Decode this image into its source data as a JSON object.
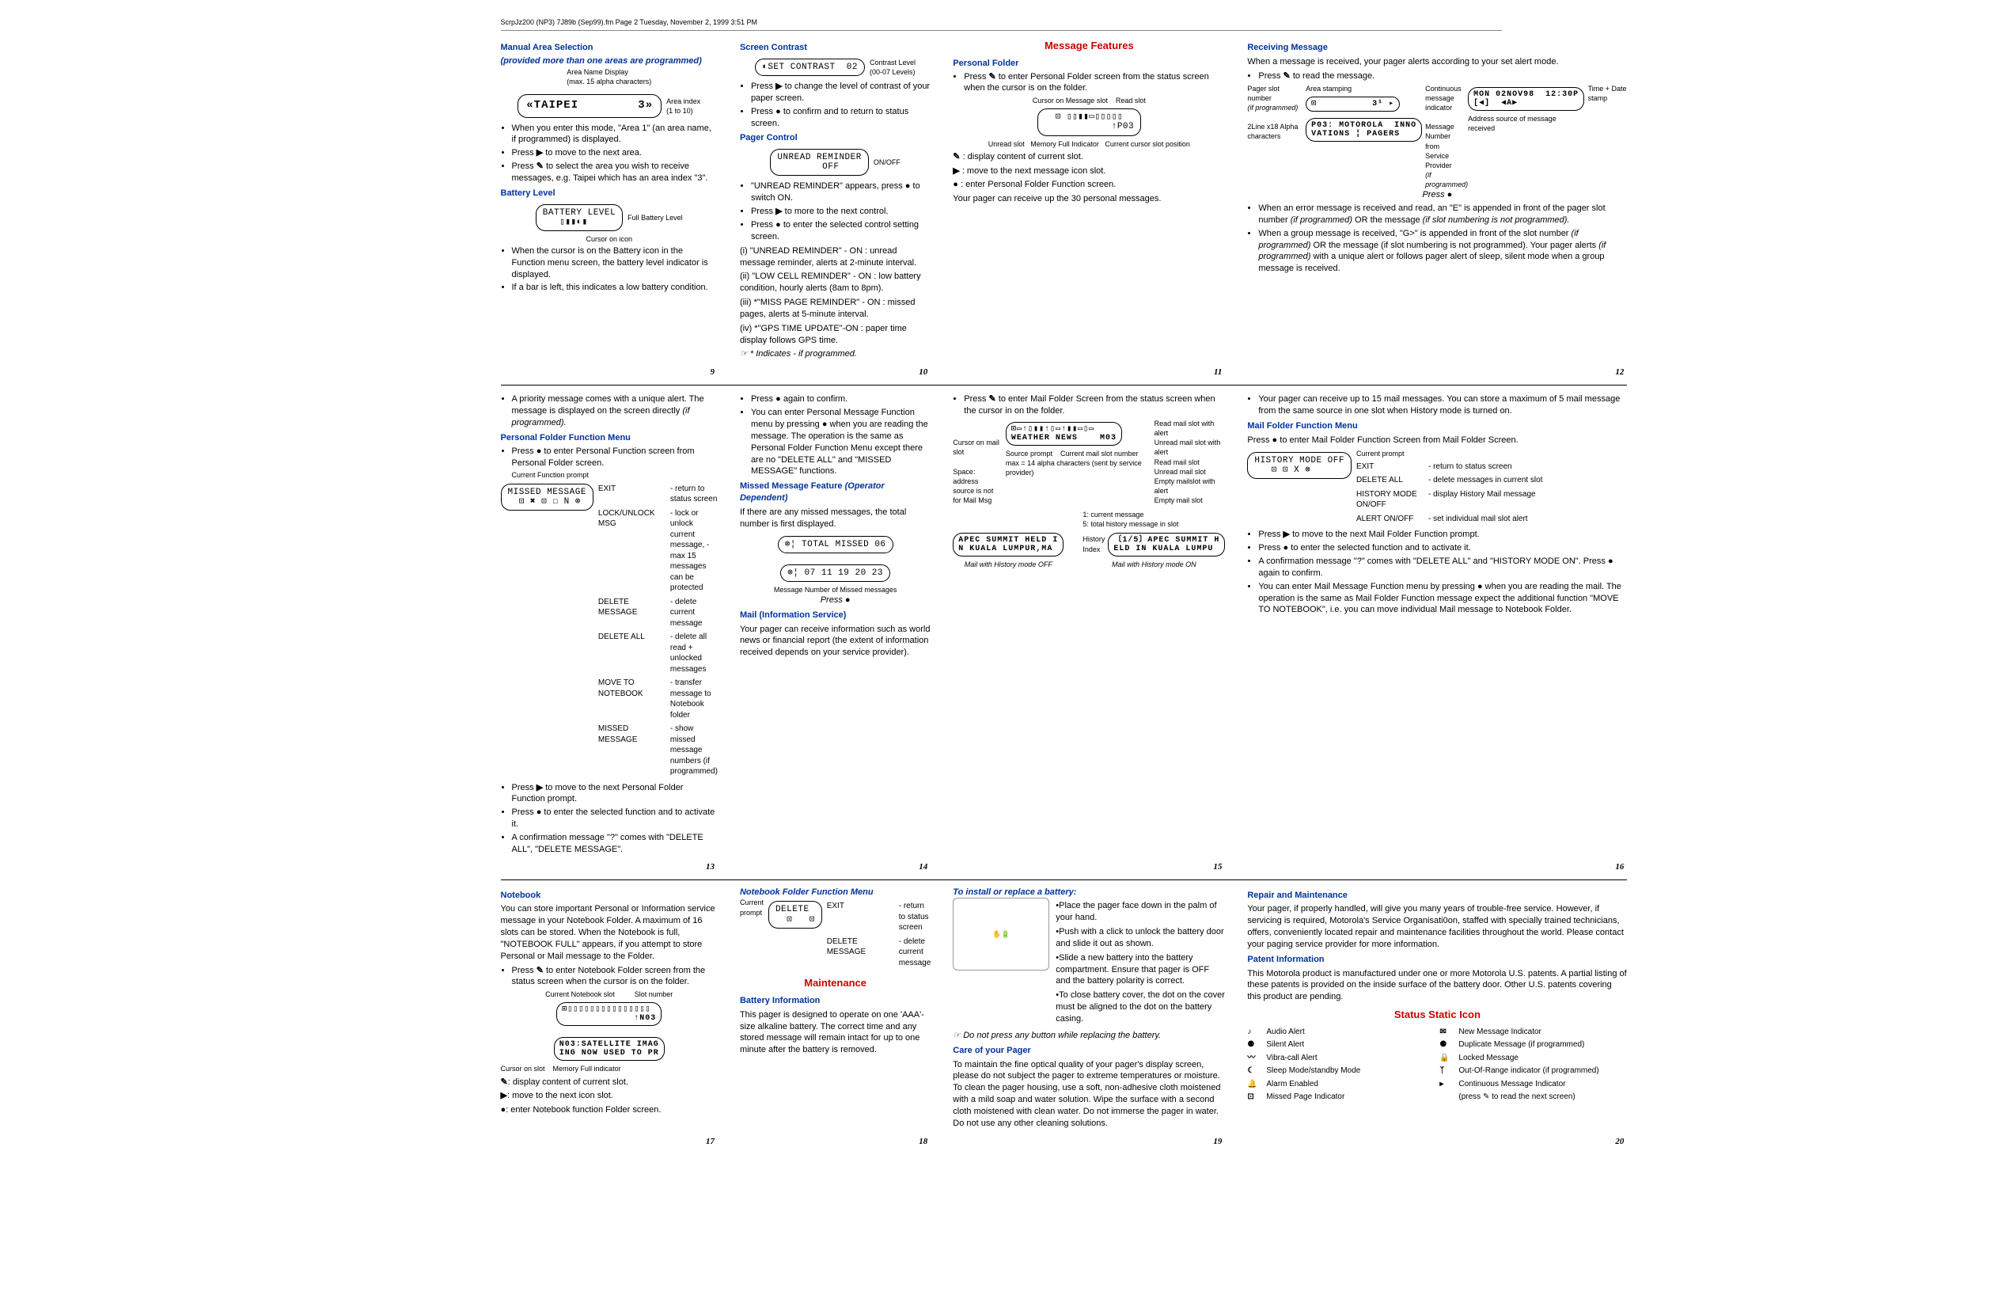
{
  "print_header": "ScrpJz200 (NP3) 7J89b (Sep99).fm  Page 2  Tuesday, November 2, 1999  3:51 PM",
  "p9": {
    "h1": "Manual Area Selection",
    "sub1": "(provided more than one areas are programmed)",
    "lcd1_label_left": "Area Name Display",
    "lcd1_label_left_note": "(max. 15 alpha characters)",
    "lcd1_text": "«TAIPEI        3»",
    "lcd1_label_right": "Area index",
    "lcd1_label_right_note": "(1 to 10)",
    "b1": "When you enter this mode, \"Area 1\" (an area name, if programmed) is displayed.",
    "b2a": "Press ",
    "b2b": " to move to the next area.",
    "b3a": "Press ",
    "b3b": " to select the area you wish to receive messages, e.g. Taipei which has an area index \"3\".",
    "h2": "Battery Level",
    "lcd2_text": "BATTERY LEVEL\n   ▯▮▮◐▮",
    "lcd2_label_r": "Full Battery Level",
    "lcd2_label_b": "Cursor on icon",
    "b4": "When the cursor is on the Battery icon in the Function menu screen, the battery level indicator is displayed.",
    "b5": "If a bar is left, this indicates a low battery condition.",
    "num": "9"
  },
  "p10": {
    "h1": "Screen Contrast",
    "lcd1_text": "◐SET CONTRAST  02",
    "lcd1_label": "Contrast Level",
    "lcd1_label2": "(00-07 Levels)",
    "b1a": "Press ",
    "b1b": " to change the level of contrast of your paper screen.",
    "b2a": "Press ",
    "b2b": " to confirm and to return to status screen.",
    "h2": "Pager Control",
    "lcd2_text": "UNREAD REMINDER\n        OFF",
    "lcd2_label": "ON/OFF",
    "b3a": "\"UNREAD REMINDER\" appears, press ",
    "b3b": " to switch ON.",
    "b4a": "Press ",
    "b4b": " to more to the next control.",
    "b5a": "Press ",
    "b5b": " to enter the selected control setting screen.",
    "i1": "(i) \"UNREAD REMINDER\" - ON : unread message reminder, alerts at 2-minute interval.",
    "i2": "(ii) \"LOW CELL REMINDER\" - ON : low battery condition, hourly alerts (8am to 8pm).",
    "i3": "(iii) *\"MISS PAGE REMINDER\" - ON : missed pages, alerts at 5-minute interval.",
    "i4": "(iv) *\"GPS TIME UPDATE\"-ON : paper time display follows GPS time.",
    "note": "☞  * Indicates - if programmed.",
    "num": "10"
  },
  "p11": {
    "title": "Message Features",
    "h1": "Personal Folder",
    "b1a": "Press ",
    "b1b": " to enter Personal Folder screen from the status screen when the cursor is on the folder.",
    "lcd_labels": {
      "l1": "Cursor on Message slot",
      "l2": "Read slot",
      "l3": "Unread slot",
      "l4": "Memory Full Indicator",
      "l5": "Current cursor slot position"
    },
    "lcd1_text": "⊡ ▯▯▮▮▭▯▯▯▯▯\n            ↑P03",
    "k1a": " : display content of current slot.",
    "k2a": " : move to the next message icon slot.",
    "k3a": " : enter Personal Folder Function screen.",
    "b2": "Your pager can receive up the 30 personal messages.",
    "num": "11"
  },
  "p12": {
    "h1": "Receiving Message",
    "b1": "When a message is received, your pager alerts according to your set alert mode.",
    "b2a": "Press ",
    "b2b": " to read the message.",
    "labels": {
      "l1": "Pager slot number",
      "l1i": "(if programmed)",
      "l2": "Area stamping",
      "l3": "Continuous message indicator",
      "l4": "Message Number from Service Provider",
      "l4i": "(if programmed)",
      "l5": "Time + Date stamp",
      "l6": "2Line x18 Alpha characters",
      "l7": "Address source of message received"
    },
    "lcd1_text": "⊡          3¹ ▸",
    "lcd2_text": "P03: MOTOROLA  INNO\nVATIONS ¦ PAGERS",
    "lcd3_text": "MON 02NOV98  12:30P\n[◀]  ◀A▶",
    "press": "Press ●",
    "b3pre": "When an error message is received and read, an \"E\" is appended in front of the pager slot number ",
    "b3i1": "(if programmed)",
    "b3mid": " OR the message ",
    "b3i2": "(if slot numbering is not programmed).",
    "b4pre": "When a group message is received, \"G>\" is appended in front of the slot number ",
    "b4i1": "(if programmed)",
    "b4mid": " OR the message (if slot numbering is not programmed). Your pager alerts ",
    "b4i2": "(if programmed)",
    "b4post": " with a unique alert or follows pager alert of sleep, silent mode when a group message is received.",
    "num": "12"
  },
  "p13": {
    "b1pre": "A priority message comes with a unique alert. The message is displayed on the screen directly ",
    "b1i": "(if programmed).",
    "h1": "Personal Folder Function Menu",
    "b2a": "Press ",
    "b2b": " to enter Personal Function screen from Personal Folder screen.",
    "cfp": "Current Function prompt",
    "lcd_text": "MISSED MESSAGE\n  ⊡ ✖ ⊡ ☐ N ⊗",
    "legend": {
      "r1a": "EXIT",
      "r1b": "- return to status screen",
      "r2a": "LOCK/UNLOCK MSG",
      "r2b": "- lock or unlock current message, - max 15 messages can be protected",
      "r3a": "DELETE MESSAGE",
      "r3b": "- delete current message",
      "r4a": "DELETE ALL",
      "r4b": "- delete all read + unlocked messages",
      "r5a": "MOVE TO NOTEBOOK",
      "r5b": "- transfer message to Notebook folder",
      "r6a": "MISSED MESSAGE",
      "r6b": "- show missed message numbers (if programmed)"
    },
    "b3a": "Press ",
    "b3b": " to move to the next Personal Folder Function prompt.",
    "b4a": "Press ",
    "b4b": " to enter the selected function and to activate it.",
    "b5": "A confirmation message \"?\" comes with \"DELETE ALL\", \"DELETE MESSAGE\".",
    "num": "13"
  },
  "p14": {
    "b1a": "Press ",
    "b1b": " again to confirm.",
    "b2a": "You can enter Personal Message Function menu by pressing ",
    "b2b": " when you are reading the message. The operation is the same as Personal Folder Function Menu except there are no \"DELETE ALL\" and \"MISSED MESSAGE\" functions.",
    "h1": "Missed Message Feature ",
    "h1i": "(Operator Dependent)",
    "p1": "If there are any missed messages, the total number is first displayed.",
    "lcd1_text": "⊗¦ TOTAL MISSED 06",
    "lcd2_text": "⊗¦ 07 11 19 20 23",
    "lcd2_label": "Message Number of Missed messages",
    "press": "Press ●",
    "h2": "Mail (Information Service)",
    "p2": "Your pager can receive information such as world news or financial report (the extent of information received depends on your service provider).",
    "num": "14"
  },
  "p15": {
    "b1a": "Press ",
    "b1b": " to enter Mail Folder Screen from the status screen when the cursor in on the folder.",
    "labels": {
      "l1": "Read mail slot with alert",
      "l2": "Unread mail slot with alert",
      "l3": "Read mail slot",
      "l4": "Unread mail slot",
      "l5": "Empty mailslot with alert",
      "l6": "Empty mail slot",
      "l7": "Cursor on mail slot",
      "l8": "Space: address source is not for Mail Msg",
      "l9": "Source prompt",
      "l9n": "max = 14 alpha characters (sent by service provider)",
      "l10": "Current mail slot number"
    },
    "lcd1_text": "⊡▭↑▯▮▮↑▯▭↑▮▮▭▯▭\nWEATHER NEWS    M03",
    "lcd2_text": "APEC SUMMIT HELD I\nN KUALA LUMPUR,MA",
    "lcd3_text": "〔1/5〕APEC SUMMIT H\nELD IN KUALA LUMPU",
    "cap2": "Mail with History mode OFF",
    "cap3": "Mail with History mode ON",
    "hist_label": "History Index",
    "hist_n1": "1: current message",
    "hist_n2": "5: total history message in slot",
    "num": "15"
  },
  "p16": {
    "b1": "Your pager can receive up to 15 mail messages. You can store a maximum of 5 mail message from the same source in one slot when History mode is turned on.",
    "h1": "Mail Folder Function Menu",
    "p1a": "Press ",
    "p1b": " to enter Mail Folder Function Screen from Mail Folder Screen.",
    "lcd_text": "HISTORY MODE OFF\n   ⊡ ⊡ X ⊗",
    "cp": "Current prompt",
    "legend": {
      "r1a": "EXIT",
      "r1b": "- return to status screen",
      "r2a": "DELETE ALL",
      "r2b": "- delete messages in current slot",
      "r3a": "HISTORY MODE ON/OFF",
      "r3b": "- display History Mail message",
      "r4a": "ALERT ON/OFF",
      "r4b": "- set individual mail slot alert"
    },
    "b2a": "Press ",
    "b2b": " to move to the next Mail Folder Function prompt.",
    "b3a": "Press ",
    "b3b": " to enter the selected function and to activate it.",
    "b4a": "A confirmation message \"?\" comes with \"DELETE ALL\" and \"HISTORY MODE ON\". Press ",
    "b4b": " again to confirm.",
    "b5a": "You can enter Mail Message Function menu by pressing ",
    "b5b": " when you are reading the mail. The operation is the same as Mail Folder Function message expect the additional function \"MOVE TO NOTEBOOK\", i.e. you can move individual Mail message to Notebook Folder.",
    "num": "16"
  },
  "p17": {
    "h1": "Notebook",
    "p1": "You can store important Personal or Information service message in your Notebook Folder. A maximum of 16 slots can be stored. When the Notebook is full, \"NOTEBOOK FULL\" appears, if you attempt to store Personal or Mail message to the Folder.",
    "b1a": "Press ",
    "b1b": " to enter Notebook Folder screen from the status screen when the cursor is on the folder.",
    "labels": {
      "l1": "Current Notebook slot",
      "l2": "Slot number",
      "l3": "Cursor on slot",
      "l4": "Memory Full indicator"
    },
    "lcd1_text": "⊡▯▯▯▯▯▯▯▯▯▯▯▯▯▯▯\n             ↑N03",
    "lcd2_text": "N03:SATELLITE IMAG\nING NOW USED TO PR",
    "k1": ": display content of current slot.",
    "k2": ": move to the next icon slot.",
    "k3": ": enter Notebook function Folder screen.",
    "num": "17"
  },
  "p18": {
    "h1": "Notebook Folder Function Menu",
    "cp": "Current prompt",
    "lcd_text": "DELETE\n  ⊡   ⊡",
    "legend": {
      "r1a": "EXIT",
      "r1b": "- return to status screen",
      "r2a": "DELETE MESSAGE",
      "r2b": "- delete current message"
    },
    "title": "Maintenance",
    "h2": "Battery Information",
    "p1": "This pager is designed to operate on one 'AAA'-size alkaline battery. The correct time and any stored message will remain intact for up to one minute after the battery is removed.",
    "num": "18"
  },
  "p19": {
    "h1": "To install or replace a battery:",
    "b1": "Place the pager face down in the palm of your hand.",
    "b2": "Push with a click to unlock the battery door and slide it out as shown.",
    "b3": "Slide a new battery into the battery compartment. Ensure that pager is OFF and the battery polarity is correct.",
    "b4": "To close battery cover, the dot on the cover must be aligned to the dot on the battery casing.",
    "note": "☞  Do not press any button while replacing the battery.",
    "h2": "Care of your Pager",
    "p1": "To maintain the fine optical quality of your pager's display screen, please do not subject the pager to extreme temperatures or moisture. To clean the pager housing, use a soft, non-adhesive cloth moistened with a mild soap and water solution. Wipe the surface with a second cloth moistened with clean water. Do not immerse the pager in water. Do not use any other cleaning solutions.",
    "num": "19"
  },
  "p20": {
    "h1": "Repair and Maintenance",
    "p1": "Your pager, if properly handled, will give you many years of trouble-free service. However, if servicing is required, Motorola's Service Organisati0on, staffed with specially trained technicians, offers, conveniently located repair and maintenance facilities throughout the world. Please contact your paging service provider for more information.",
    "h2": "Patent Information",
    "p2": "This Motorola product is manufactured under one or more Motorola U.S. patents. A partial listing of these patents is provided on the inside surface of the battery door. Other U.S. patents covering this product are pending.",
    "title": "Status Static Icon",
    "status": [
      [
        "♪",
        "Audio Alert",
        "✉",
        "New Message Indicator"
      ],
      [
        "⚈",
        "Silent Alert",
        "⚈",
        "Duplicate Message (if programmed)"
      ],
      [
        "〰",
        "Vibra-call Alert",
        "🔒",
        "Locked Message"
      ],
      [
        "☾",
        "Sleep Mode/standby Mode",
        "ᛉ",
        "Out-Of-Range indicator (if programmed)"
      ],
      [
        "🔔",
        "Alarm Enabled",
        "▸",
        "Continuous Message Indicator"
      ],
      [
        "⊡",
        "Missed Page Indicator",
        "",
        "(press ✎ to read the next screen)"
      ]
    ],
    "num": "20"
  }
}
